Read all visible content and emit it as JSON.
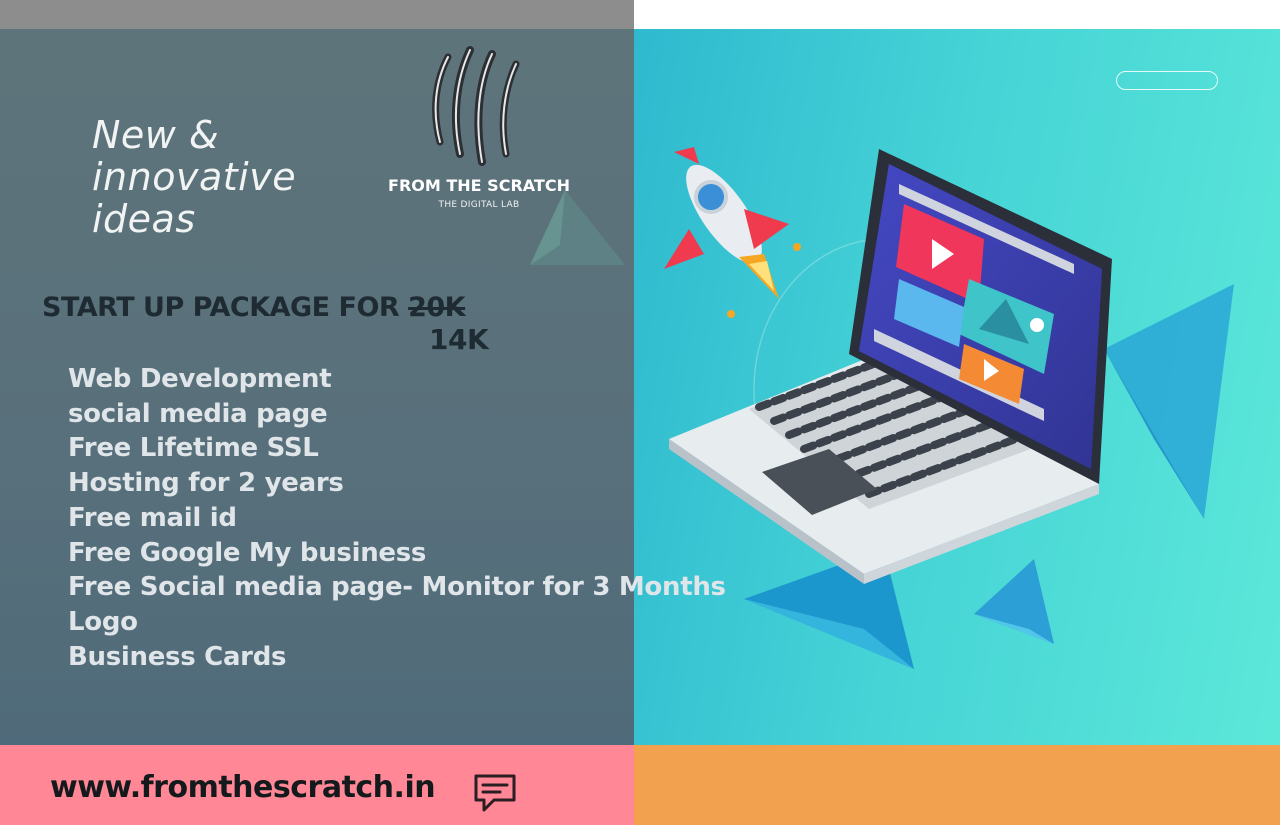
{
  "brand": {
    "name": "FROM THE SCRATCH",
    "subtitle": "THE DIGITAL LAB"
  },
  "tagline": [
    "New &",
    "innovative",
    "ideas"
  ],
  "package": {
    "title_prefix": "START UP PACKAGE FOR",
    "old_price": "20K",
    "new_price": "14K"
  },
  "features": [
    "Web Development",
    "social media page",
    "Free Lifetime SSL",
    "Hosting for 2 years",
    "Free mail id",
    "Free Google My business",
    "Free Social media page- Monitor for 3 Months",
    "Logo",
    "Business Cards"
  ],
  "footer": {
    "url": "www.fromthescratch.in",
    "contact_icon": "chat-bubble-icon"
  },
  "colors": {
    "left_panel": "#5e747b",
    "right_panel": "#45d3d6",
    "bottom_left": "#ff8796",
    "bottom_right": "#f2a24e"
  }
}
